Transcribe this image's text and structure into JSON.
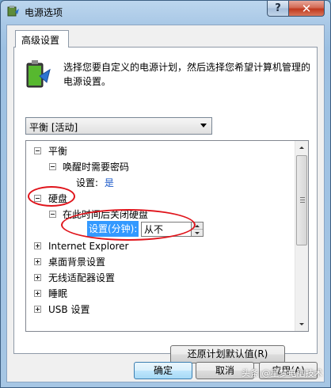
{
  "window": {
    "title": "电源选项",
    "help_label": "?",
    "close_label": "✕"
  },
  "tab": {
    "label": "高级设置"
  },
  "intro_text": "选择您要自定义的电源计划，然后选择您希望计算机管理的电源设置。",
  "plan_select": {
    "value": "平衡 [活动]"
  },
  "tree": {
    "balanced": "平衡",
    "wake_password": "唤醒时需要密码",
    "wake_setting_label": "设置:",
    "wake_setting_value": "是",
    "hard_disk": "硬盘",
    "turn_off_after": "在此时间后关闭硬盘",
    "minutes_label": "设置(分钟):",
    "minutes_value": "从不",
    "ie": "Internet Explorer",
    "desktop_bg": "桌面背景设置",
    "wireless": "无线适配器设置",
    "sleep": "睡眠",
    "usb": "USB 设置"
  },
  "restore_button": "还原计划默认值(R)",
  "buttons": {
    "ok": "确定",
    "cancel": "取消",
    "apply": "应用(A)"
  },
  "watermark": "头条 @星梦电脑技术",
  "colors": {
    "selection": "#3399ff",
    "annotation": "#e0141b",
    "link_value": "#1a58c8"
  }
}
